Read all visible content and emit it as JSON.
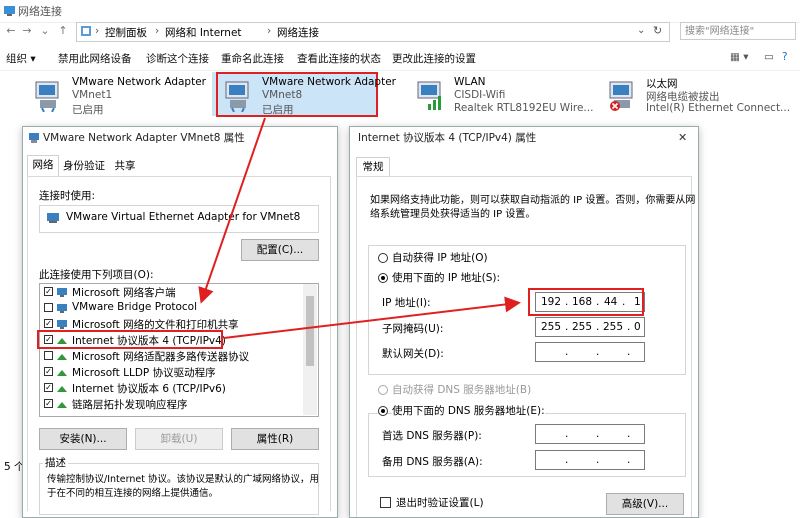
{
  "window": {
    "title": "网络连接"
  },
  "address": {
    "crumbs": [
      "控制面板",
      "网络和 Internet",
      "网络连接"
    ],
    "separator": "›",
    "search_placeholder": "搜索\"网络连接\""
  },
  "commands": [
    "组织 ▾",
    "禁用此网络设备",
    "诊断这个连接",
    "重命名此连接",
    "查看此连接的状态",
    "更改此连接的设置"
  ],
  "adapters": [
    {
      "name": "VMware Network Adapter",
      "line2": "VMnet1",
      "line3": "已启用"
    },
    {
      "name": "VMware Network Adapter",
      "line2": "VMnet8",
      "line3": "已启用"
    },
    {
      "name": "WLAN",
      "line2": "CISDI-Wifi",
      "line3": "Realtek RTL8192EU Wire..."
    },
    {
      "name": "以太网",
      "line2": "网络电缆被拔出",
      "line3": "Intel(R) Ethernet Connect..."
    }
  ],
  "status_left": "5 个",
  "props": {
    "title": "VMware Network Adapter VMnet8 属性",
    "tabs": [
      "网络",
      "身份验证",
      "共享"
    ],
    "connect_using_label": "连接时使用:",
    "adapter_name": "VMware Virtual Ethernet Adapter for VMnet8",
    "configure_button": "配置(C)...",
    "items_label": "此连接使用下列项目(O):",
    "items": [
      {
        "label": "Microsoft 网络客户端",
        "checked": true
      },
      {
        "label": "VMware Bridge Protocol",
        "checked": false
      },
      {
        "label": "Microsoft 网络的文件和打印机共享",
        "checked": true
      },
      {
        "label": "Internet 协议版本 4 (TCP/IPv4)",
        "checked": true
      },
      {
        "label": "Microsoft 网络适配器多路传送器协议",
        "checked": false
      },
      {
        "label": "Microsoft LLDP 协议驱动程序",
        "checked": true
      },
      {
        "label": "Internet 协议版本 6 (TCP/IPv6)",
        "checked": true
      },
      {
        "label": "链路层拓扑发现响应程序",
        "checked": true
      }
    ],
    "install_button": "安装(N)...",
    "uninstall_button": "卸载(U)",
    "properties_button": "属性(R)",
    "description_title": "描述",
    "description_line1": "传输控制协议/Internet 协议。该协议是默认的广域网络协议，用",
    "description_line2": "于在不同的相互连接的网络上提供通信。"
  },
  "ipv4": {
    "title": "Internet 协议版本 4 (TCP/IPv4) 属性",
    "close": "✕",
    "tab": "常规",
    "intro_line1": "如果网络支持此功能，则可以获取自动指派的 IP 设置。否则，你需要从网",
    "intro_line2": "络系统管理员处获得适当的 IP 设置。",
    "auto_ip": "自动获得 IP 地址(O)",
    "manual_ip": "使用下面的 IP 地址(S):",
    "ip_label": "IP 地址(I):",
    "ip": [
      "192",
      "168",
      "44",
      "1"
    ],
    "mask_label": "子网掩码(U):",
    "mask": [
      "255",
      "255",
      "255",
      "0"
    ],
    "gateway_label": "默认网关(D):",
    "auto_dns": "自动获得 DNS 服务器地址(B)",
    "manual_dns": "使用下面的 DNS 服务器地址(E):",
    "dns1_label": "首选 DNS 服务器(P):",
    "dns2_label": "备用 DNS 服务器(A):",
    "dot": ".",
    "validate_label": "退出时验证设置(L)",
    "advanced_button": "高级(V)..."
  },
  "colors": {
    "highlight_red": "#e02020",
    "accent": "#0078d7"
  }
}
